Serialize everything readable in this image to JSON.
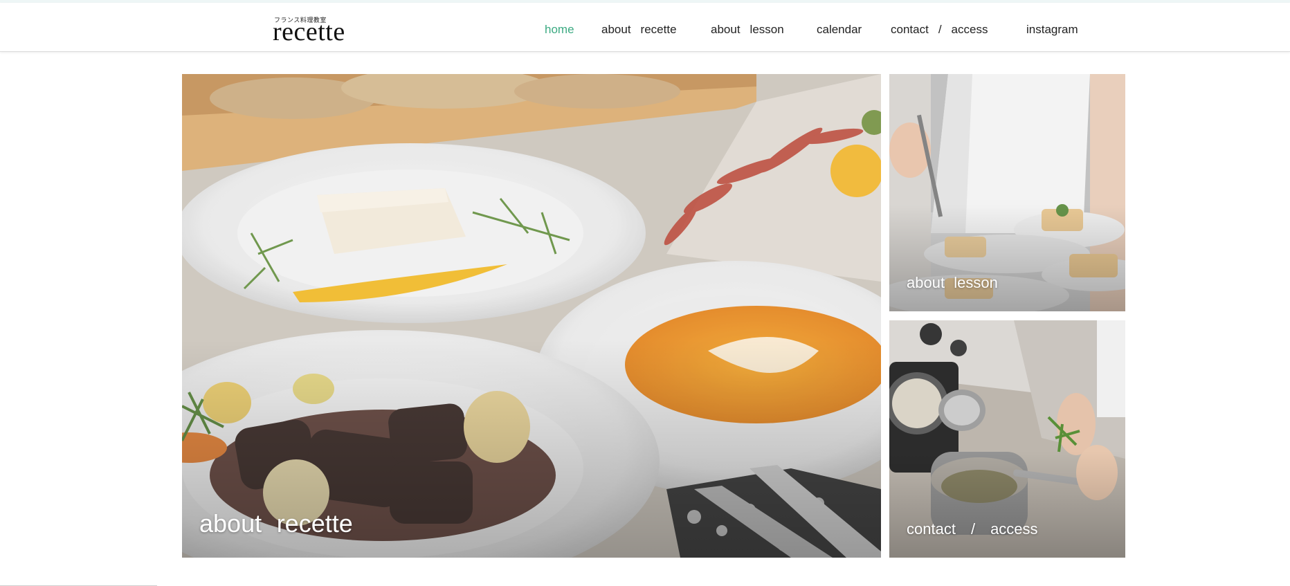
{
  "header": {
    "logo": {
      "subtitle": "フランス料理教室",
      "title": "recette"
    },
    "nav": [
      {
        "label": "home",
        "active": true
      },
      {
        "label_a": "about",
        "label_b": "recette"
      },
      {
        "label_a": "about",
        "label_b": "lesson"
      },
      {
        "label": "calendar"
      },
      {
        "label_a": "contact",
        "label_b": "/",
        "label_c": "access"
      },
      {
        "label": "instagram"
      }
    ],
    "active_color": "#3caa82"
  },
  "tiles": {
    "recette": {
      "word1": "about",
      "word2": "recette",
      "image": "french-dinner-plates-photo"
    },
    "lesson": {
      "word1": "about",
      "word2": "lesson",
      "image": "cooking-lesson-plating-photo"
    },
    "access": {
      "word1": "contact",
      "word2": "/",
      "word3": "access",
      "image": "kitchen-cooking-photo"
    }
  }
}
